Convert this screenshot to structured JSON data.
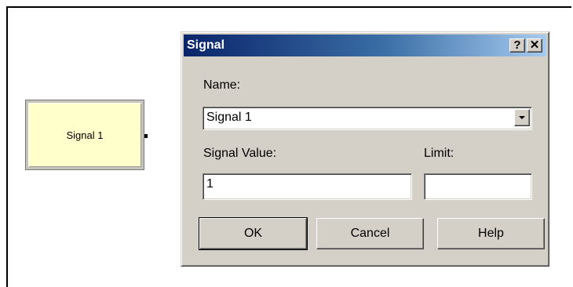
{
  "module": {
    "label": "Signal 1"
  },
  "dialog": {
    "title": "Signal",
    "help_button": "?",
    "close_button": "✕",
    "name_label": "Name:",
    "name_value": "Signal 1",
    "signal_value_label": "Signal Value:",
    "signal_value": "1",
    "limit_label": "Limit:",
    "limit_value": "",
    "ok_label": "OK",
    "cancel_label": "Cancel",
    "help_label": "Help"
  }
}
